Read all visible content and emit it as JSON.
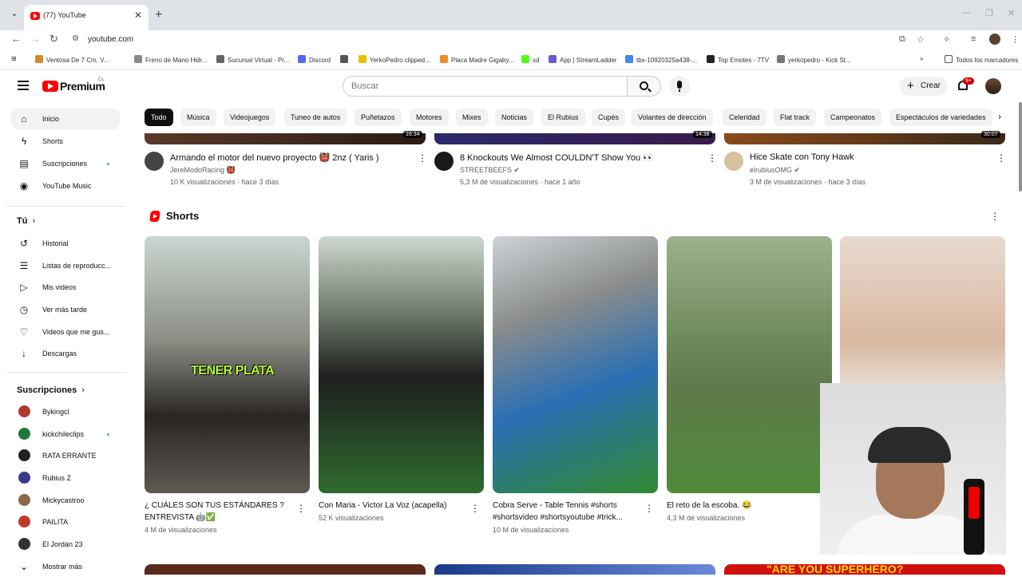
{
  "browser": {
    "tab_title": "(77) YouTube",
    "url": "youtube.com",
    "bookmarks": [
      {
        "label": "Ventosa De 7 Cm, V...",
        "color": "#c98b2b"
      },
      {
        "label": "Freno de Mano Hidr...",
        "color": "#888888"
      },
      {
        "label": "Sucursal Virtual - Pr...",
        "color": "#666666"
      },
      {
        "label": "Discord",
        "color": "#5865f2"
      },
      {
        "label": "",
        "color": "#555555"
      },
      {
        "label": "YerkoPedro clipped...",
        "color": "#e6c200"
      },
      {
        "label": "Placa Madre Gigaby...",
        "color": "#f08a24"
      },
      {
        "label": "xd",
        "color": "#53fc18"
      },
      {
        "label": "App | StreamLadder",
        "color": "#6a5acd"
      },
      {
        "label": "tbx-10920325a438-...",
        "color": "#4285f4"
      },
      {
        "label": "Top Emotes - 7TV",
        "color": "#222222"
      },
      {
        "label": "yerkopedro - Kick St...",
        "color": "#777777"
      }
    ],
    "all_bookmarks": "Todos los marcadores"
  },
  "masthead": {
    "logo_text": "Premium",
    "region": "CL",
    "search_placeholder": "Buscar",
    "create_label": "Crear",
    "notif_badge": "9+"
  },
  "sidebar": {
    "main": [
      {
        "label": "Inicio",
        "icon": "home-icon",
        "active": true
      },
      {
        "label": "Shorts",
        "icon": "shorts-icon"
      },
      {
        "label": "Suscripciones",
        "icon": "subscriptions-icon",
        "dot": true
      },
      {
        "label": "YouTube Music",
        "icon": "music-icon"
      }
    ],
    "you_heading": "Tú",
    "you": [
      {
        "label": "Historial",
        "icon": "history-icon"
      },
      {
        "label": "Listas de reproducc...",
        "icon": "playlists-icon"
      },
      {
        "label": "Mis videos",
        "icon": "my-videos-icon"
      },
      {
        "label": "Ver más tarde",
        "icon": "watch-later-icon"
      },
      {
        "label": "Videos que me gus...",
        "icon": "liked-icon"
      },
      {
        "label": "Descargas",
        "icon": "downloads-icon"
      }
    ],
    "subs_heading": "Suscripciones",
    "subs": [
      {
        "label": "Bykingcl",
        "color": "#b03a2e"
      },
      {
        "label": "kickchileclips",
        "color": "#1f7a3a",
        "dot": true
      },
      {
        "label": "RATA ERRANTE",
        "color": "#222222"
      },
      {
        "label": "Rubius Z",
        "color": "#3b3b8a"
      },
      {
        "label": "Mickycastroo",
        "color": "#8a6a4a"
      },
      {
        "label": "PAILITA",
        "color": "#c0392b"
      },
      {
        "label": "El Jordan 23",
        "color": "#333333"
      }
    ],
    "more": "Mostrar más"
  },
  "chips": [
    "Todo",
    "Música",
    "Videojuegos",
    "Tuneo de autos",
    "Puñetazos",
    "Motores",
    "Mixes",
    "Noticias",
    "El Rubius",
    "Cupés",
    "Volantes de dirección",
    "Celeridad",
    "Flat track",
    "Campeonatos",
    "Espectáculos de variedades"
  ],
  "videos": [
    {
      "title": "Armando el motor del nuevo proyecto 👹 2nz ( Yaris )",
      "channel": "JereModoRacing 👹",
      "meta": "10 K visualizaciones · hace 3 días",
      "duration": "16:34"
    },
    {
      "title": "8 Knockouts We Almost COULDN'T Show You 👀",
      "channel": "STREETBEEFS ✔",
      "meta": "5,3 M de visualizaciones · hace 1 año",
      "duration": "14:38"
    },
    {
      "title": "Hice Skate con Tony Hawk",
      "channel": "elrubiusOMG ✔",
      "meta": "3 M de visualizaciones · hace 3 días",
      "duration": "30:07"
    }
  ],
  "shorts": {
    "heading": "Shorts",
    "items": [
      {
        "title": "¿ CUÁLES SON TUS ESTÁNDARES ? ENTREVISTA 🤖✅",
        "views": "4 M de visualizaciones",
        "overlay": "TENER PLATA"
      },
      {
        "title": "Con Maria - Victor La Voz (acapella)",
        "views": "52 K visualizaciones"
      },
      {
        "title": "Cobra Serve - Table Tennis #shorts #shortsvideo #shortsyoutube #trick...",
        "views": "10 M de visualizaciones"
      },
      {
        "title": "El reto de la escoba. 😂",
        "views": "4,3 M de visualizaciones"
      }
    ]
  },
  "bottom_row_text": "\"ARE YOU SUPERHERO?"
}
